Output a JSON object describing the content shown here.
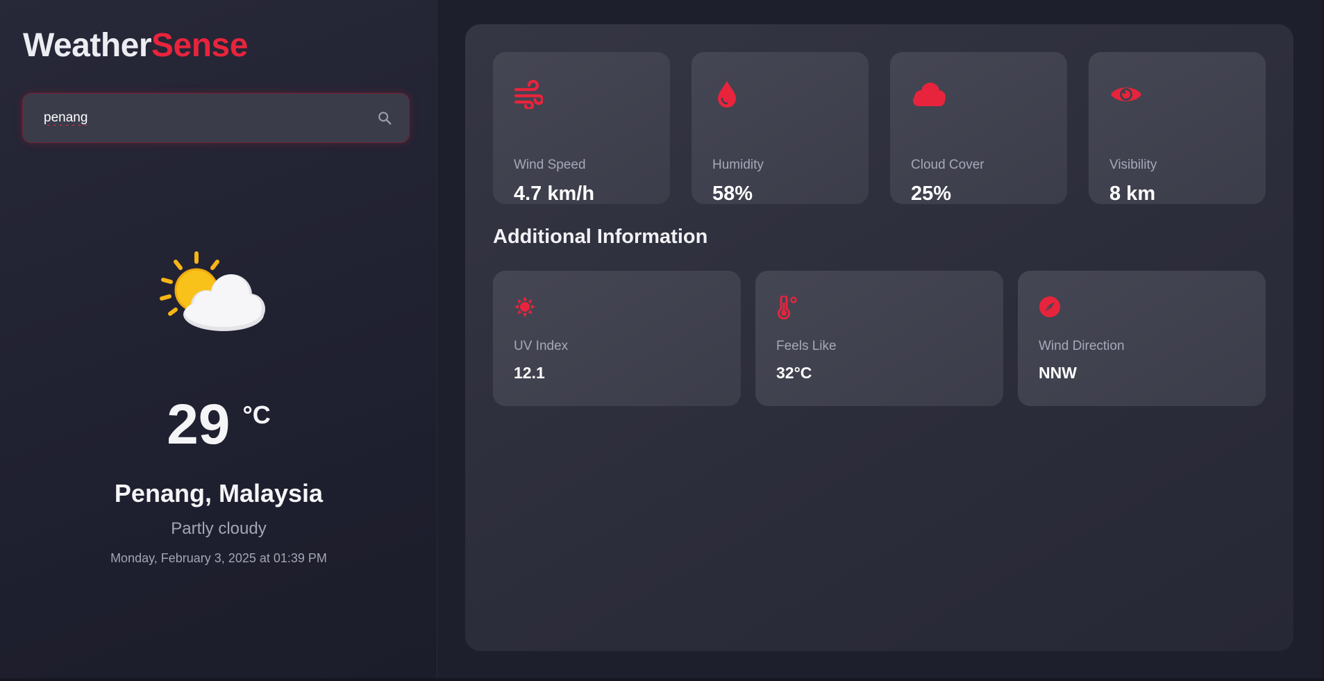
{
  "brand": {
    "part1": "Weather",
    "part2": "Sense",
    "accent": "#e8243c"
  },
  "search": {
    "value": "penang",
    "icon": "search-icon"
  },
  "current": {
    "icon": "partly-cloudy-icon",
    "temperature": "29",
    "unit": "°C",
    "location": "Penang, Malaysia",
    "condition": "Partly cloudy",
    "datetime": "Monday, February 3, 2025 at 01:39 PM"
  },
  "stats": [
    {
      "icon": "wind-icon",
      "label": "Wind Speed",
      "value": "4.7 km/h"
    },
    {
      "icon": "droplet-icon",
      "label": "Humidity",
      "value": "58%"
    },
    {
      "icon": "cloud-icon",
      "label": "Cloud Cover",
      "value": "25%"
    },
    {
      "icon": "eye-icon",
      "label": "Visibility",
      "value": "8 km"
    }
  ],
  "additional": {
    "title": "Additional Information",
    "items": [
      {
        "icon": "sun-icon",
        "label": "UV Index",
        "value": "12.1"
      },
      {
        "icon": "thermometer-icon",
        "label": "Feels Like",
        "value": "32°C"
      },
      {
        "icon": "compass-icon",
        "label": "Wind Direction",
        "value": "NNW"
      }
    ]
  }
}
